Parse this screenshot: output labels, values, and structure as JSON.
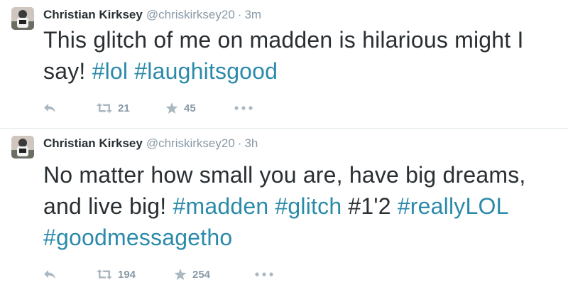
{
  "tweets": [
    {
      "name": "Christian Kirksey",
      "handle": "@chriskirksey20",
      "separator": "·",
      "time": "3m",
      "text": [
        {
          "t": "This glitch of me on madden is hilarious might I say! ",
          "hashtag": false
        },
        {
          "t": "#lol",
          "hashtag": true
        },
        {
          "t": " ",
          "hashtag": false
        },
        {
          "t": "#laughitsgood",
          "hashtag": true
        }
      ],
      "retweets": "21",
      "favorites": "45"
    },
    {
      "name": "Christian Kirksey",
      "handle": "@chriskirksey20",
      "separator": "·",
      "time": "3h",
      "text": [
        {
          "t": "No matter how small you are, have big dreams, and live big! ",
          "hashtag": false
        },
        {
          "t": "#madden",
          "hashtag": true
        },
        {
          "t": " ",
          "hashtag": false
        },
        {
          "t": "#glitch",
          "hashtag": true
        },
        {
          "t": " #1'2 ",
          "hashtag": false
        },
        {
          "t": "#reallyLOL",
          "hashtag": true
        },
        {
          "t": " ",
          "hashtag": false
        },
        {
          "t": "#goodmessagetho",
          "hashtag": true
        }
      ],
      "retweets": "194",
      "favorites": "254"
    }
  ],
  "colors": {
    "hashtag": "#2b8aaa",
    "meta": "#8899a6",
    "text": "#292f33",
    "divider": "#e1e8ed"
  },
  "icons": [
    "reply-icon",
    "retweet-icon",
    "favorite-star-icon",
    "more-dots-icon"
  ]
}
